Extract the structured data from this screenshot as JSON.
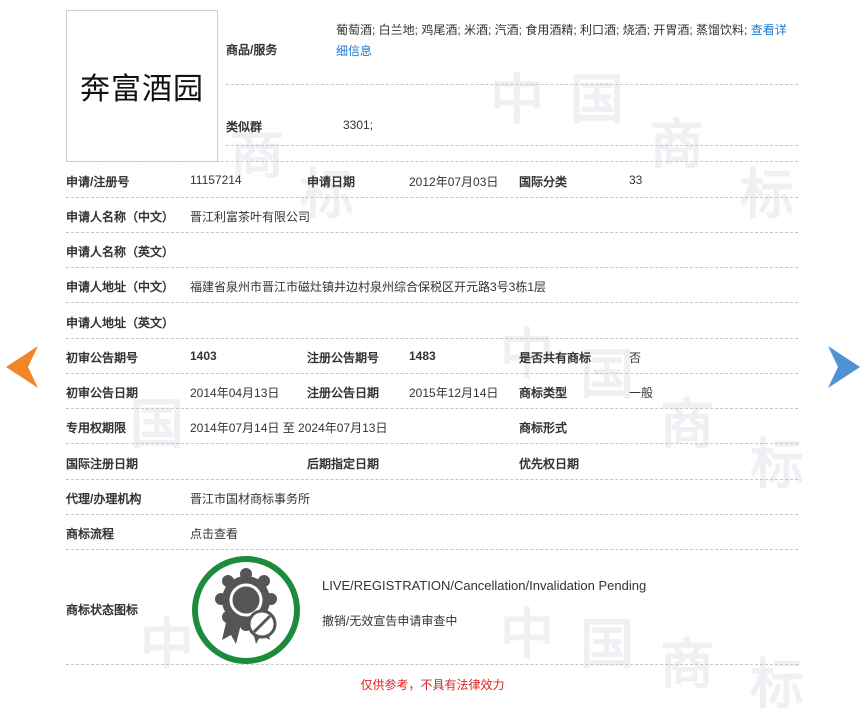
{
  "trademark": {
    "name": "奔富酒园"
  },
  "goods": {
    "label": "商品/服务",
    "text": "葡萄酒; 白兰地; 鸡尾酒; 米酒; 汽酒; 食用酒精; 利口酒; 烧酒; 开胃酒; 蒸馏饮料;",
    "more_link": "查看详细信息"
  },
  "similar_group": {
    "label": "类似群",
    "value": "3301;"
  },
  "application": {
    "reg_no_label": "申请/注册号",
    "reg_no": "11157214",
    "date_label": "申请日期",
    "date": "2012年07月03日",
    "intl_class_label": "国际分类",
    "intl_class": "33"
  },
  "applicant": {
    "name_cn_label": "申请人名称（中文）",
    "name_cn": "晋江利富茶叶有限公司",
    "name_en_label": "申请人名称（英文）",
    "name_en": "",
    "addr_cn_label": "申请人地址（中文）",
    "addr_cn": "福建省泉州市晋江市磁灶镇井边村泉州综合保税区开元路3号3栋1层",
    "addr_en_label": "申请人地址（英文）",
    "addr_en": ""
  },
  "publication": {
    "prelim_no_label": "初审公告期号",
    "prelim_no": "1403",
    "reg_no_label": "注册公告期号",
    "reg_no": "1483",
    "shared_label": "是否共有商标",
    "shared": "否",
    "prelim_date_label": "初审公告日期",
    "prelim_date": "2014年04月13日",
    "reg_date_label": "注册公告日期",
    "reg_date": "2015年12月14日",
    "type_label": "商标类型",
    "type": "一般",
    "exclusive_label": "专用权期限",
    "exclusive": "2014年07月14日 至 2024年07月13日",
    "form_label": "商标形式",
    "form": "",
    "intl_reg_label": "国际注册日期",
    "intl_reg": "",
    "later_label": "后期指定日期",
    "later": "",
    "priority_label": "优先权日期",
    "priority": ""
  },
  "agent": {
    "label": "代理/办理机构",
    "value": "晋江市国材商标事务所"
  },
  "process": {
    "label": "商标流程",
    "link": "点击查看"
  },
  "status": {
    "label": "商标状态图标",
    "en": "LIVE/REGISTRATION/Cancellation/Invalidation Pending",
    "cn": "撤销/无效宣告申请审查中",
    "icon": "cancelled-seal-icon",
    "color": "#1e8a3c"
  },
  "disclaimer": "仅供参考，不具有法律效力",
  "nav": {
    "prev_color": "#f0852a",
    "next_color": "#4f92d6"
  },
  "watermark": "中国商标"
}
